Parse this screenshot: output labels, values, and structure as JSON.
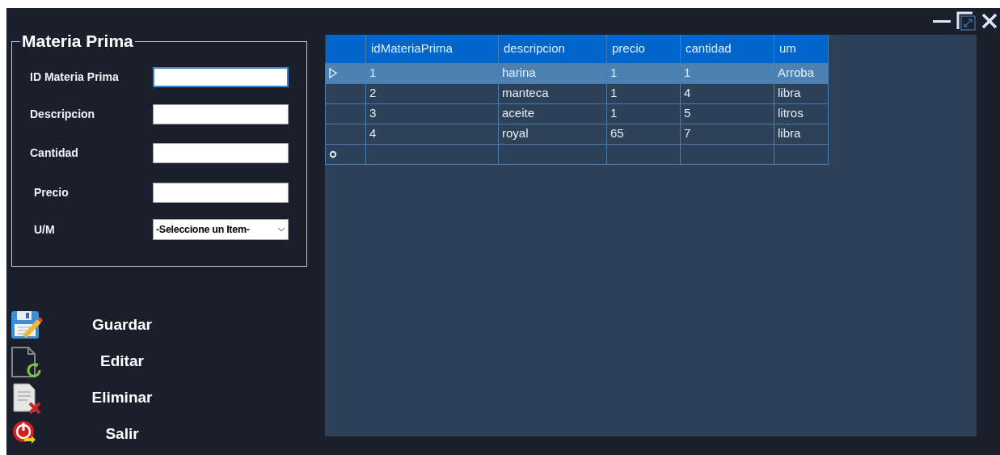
{
  "window_controls": [
    {
      "kind": "minimize"
    },
    {
      "kind": "restore"
    },
    {
      "kind": "close"
    }
  ],
  "form": {
    "title": "Materia Prima",
    "fields": [
      {
        "label": "ID Materia Prima",
        "kind": "text",
        "focused": true
      },
      {
        "label": "Descripcion",
        "kind": "text",
        "focused": false
      },
      {
        "label": "Cantidad",
        "kind": "text",
        "focused": false
      },
      {
        "label": "Precio",
        "kind": "text",
        "focused": false
      },
      {
        "label": "U/M",
        "kind": "select",
        "value": "-Seleccione un Item-",
        "focused": false
      }
    ]
  },
  "actions": [
    {
      "label": "Guardar",
      "kind": "save"
    },
    {
      "label": "Editar",
      "kind": "edit"
    },
    {
      "label": "Eliminar",
      "kind": "delete"
    },
    {
      "label": "Salir",
      "kind": "exit"
    }
  ],
  "table": {
    "columns": [
      "idMateriaPrima",
      "descripcion",
      "precio",
      "cantidad",
      "um"
    ],
    "rows": [
      {
        "cells": [
          "1",
          "harina",
          "1",
          "1",
          "Arroba"
        ],
        "selected": true
      },
      {
        "cells": [
          "2",
          "manteca",
          "1",
          "4",
          "libra"
        ],
        "selected": false
      },
      {
        "cells": [
          "3",
          "aceite",
          "1",
          "5",
          "litros"
        ],
        "selected": false
      },
      {
        "cells": [
          "4",
          "royal",
          "65",
          "7",
          "libra"
        ],
        "selected": false
      }
    ],
    "new_row": true
  }
}
